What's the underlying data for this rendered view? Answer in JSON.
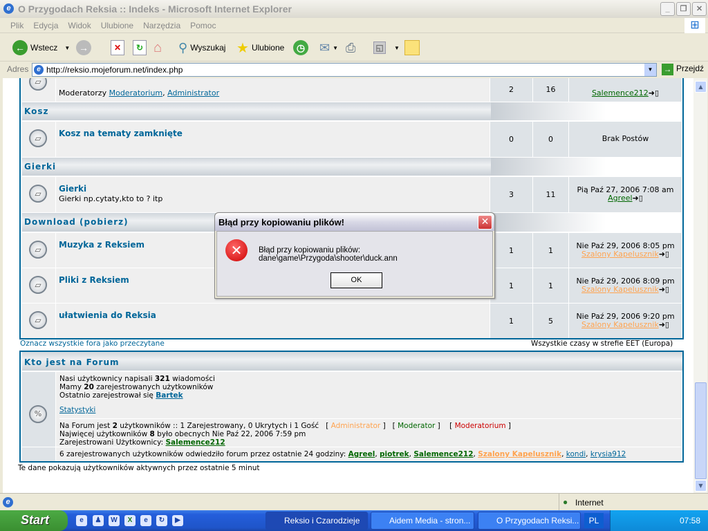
{
  "window": {
    "title": "O Przygodach Reksia :: Indeks - Microsoft Internet Explorer"
  },
  "menu": [
    "Plik",
    "Edycja",
    "Widok",
    "Ulubione",
    "Narzędzia",
    "Pomoc"
  ],
  "toolbar": {
    "back": "Wstecz",
    "search": "Wyszukaj",
    "favorites": "Ulubione"
  },
  "address": {
    "label": "Adres",
    "url": "http://reksio.mojeforum.net/index.php",
    "go": "Przejdź"
  },
  "forum": {
    "top_row": {
      "moderators_label": "Moderatorzy",
      "mod1": "Moderatorium",
      "mod2": "Administrator",
      "topics": "2",
      "posts": "16",
      "last_user": "Salemence212"
    },
    "categories": [
      {
        "name": "Kosz",
        "forums": [
          {
            "name": "Kosz na tematy zamknięte",
            "desc": "",
            "topics": "0",
            "posts": "0",
            "last_date": "Brak Postów",
            "last_user": ""
          }
        ]
      },
      {
        "name": "Gierki",
        "forums": [
          {
            "name": "Gierki",
            "desc": "Gierki np.cytaty,kto to ? itp",
            "topics": "3",
            "posts": "11",
            "last_date": "Pią Paź 27, 2006 7:08 am",
            "last_user": "Agreel"
          }
        ]
      },
      {
        "name": "Download (pobierz)",
        "forums": [
          {
            "name": "Muzyka z Reksiem",
            "desc": "",
            "topics": "1",
            "posts": "1",
            "last_date": "Nie Paź 29, 2006 8:05 pm",
            "last_user": "Szalony Kapelusznik"
          },
          {
            "name": "Pliki z Reksiem",
            "desc": "",
            "topics": "1",
            "posts": "1",
            "last_date": "Nie Paź 29, 2006 8:09 pm",
            "last_user": "Szalony Kapelusznik"
          },
          {
            "name": "ułatwienia do Reksia",
            "desc": "",
            "topics": "1",
            "posts": "5",
            "last_date": "Nie Paź 29, 2006 9:20 pm",
            "last_user": "Szalony Kapelusznik"
          }
        ]
      }
    ],
    "mark_read": "Oznacz wszystkie fora jako przeczytane",
    "timezone": "Wszystkie czasy w strefie EET (Europa)"
  },
  "who": {
    "title": "Kto jest na Forum",
    "l1a": "Nasi użytkownicy napisali ",
    "posts": "321",
    "l1b": " wiadomości",
    "l2a": "Mamy ",
    "users": "20",
    "l2b": " zarejestrowanych użytkowników",
    "l3a": "Ostatnio zarejestrował się ",
    "newest": "Bartek",
    "stats": "Statystyki",
    "l4a": "Na Forum jest ",
    "online": "2",
    "l4b": " użytkowników :: 1 Zarejestrowany, 0 Ukrytych i 1 Gość",
    "legend": [
      "Administrator",
      "Moderator",
      "Moderatorium"
    ],
    "l5a": "Najwięcej użytkowników ",
    "max": "8",
    "l5b": " było obecnych Nie Paź 22, 2006 7:59 pm",
    "l6a": "Zarejestrowani Użytkownicy: ",
    "reg_user": "Salemence212",
    "l7": "6 zarejestrowanych użytkowników odwiedziło forum przez ostatnie 24 godziny: ",
    "visitors": [
      "Agreel",
      "piotrek",
      "Salemence212",
      "Szalony Kapelusznik",
      "kondi",
      "krysia912"
    ],
    "footer": "Te dane pokazują użytkowników aktywnych przez ostatnie 5 minut"
  },
  "dialog": {
    "title": "Błąd przy kopiowaniu plików!",
    "message": "Błąd przy kopiowaniu plików: dane\\game\\Przygoda\\shooter\\duck.ann",
    "ok": "OK"
  },
  "status": {
    "zone": "Internet"
  },
  "taskbar": {
    "start": "Start",
    "tasks": [
      "Reksio i Czarodzieje",
      "Aidem Media - stron...",
      "O Przygodach Reksi..."
    ],
    "lang": "PL",
    "clock": "07:58"
  }
}
